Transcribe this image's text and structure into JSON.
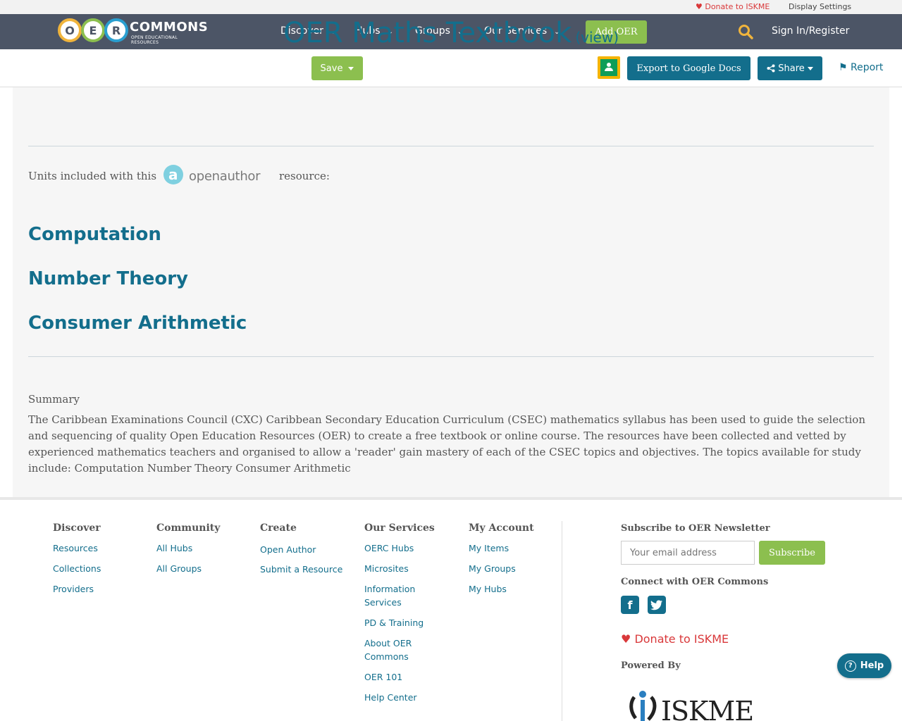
{
  "util_bar": {
    "donate": "Donate to ISKME",
    "display_settings": "Display Settings"
  },
  "logo": {
    "letters": [
      "O",
      "E",
      "R"
    ],
    "name": "COMMONS",
    "tagline": "OPEN EDUCATIONAL RESOURCES"
  },
  "nav": {
    "items": [
      {
        "label": "Discover"
      },
      {
        "label": "Hubs"
      },
      {
        "label": "Groups"
      },
      {
        "label": "Our Services"
      }
    ],
    "add_oer": "Add OER",
    "search_icon": "search-icon",
    "sign_in": "Sign In/Register"
  },
  "toolbar": {
    "save": "Save",
    "classroom_icon": "google-classroom-icon",
    "export": "Export to Google Docs",
    "share": "Share",
    "report": "Report"
  },
  "page": {
    "title": "OER Maths Textbook",
    "view_link": "(view)",
    "units_label": "Units included with this",
    "openauthor_logo": "openauthor",
    "resource_label": "resource:",
    "units": [
      "Computation",
      "Number Theory",
      "Consumer Arithmetic"
    ],
    "summary_heading": "Summary",
    "summary_text": "The Caribbean Examinations Council (CXC) Caribbean Secondary Education Curriculum (CSEC) mathematics syllabus has been used to guide the selection and sequencing of quality Open Education Resources (OER) to create a free textbook or online course. The resources have been collected and vetted by experienced mathematics teachers and organised to allow a 'reader' gain mastery of each of the CSEC topics and objectives. The topics available for study include: Computation Number Theory Consumer Arithmetic"
  },
  "footer": {
    "columns": [
      {
        "heading": "Discover",
        "links": [
          "Resources",
          "Collections",
          "Providers"
        ]
      },
      {
        "heading": "Community",
        "links": [
          "All Hubs",
          "All Groups"
        ]
      },
      {
        "heading": "Create",
        "links": [
          "Open Author",
          "Submit a Resource"
        ]
      },
      {
        "heading": "Our Services",
        "links": [
          "OERC Hubs",
          "Microsites",
          "Information Services",
          "PD & Training",
          "About OER Commons",
          "OER 101",
          "Help Center"
        ]
      },
      {
        "heading": "My Account",
        "links": [
          "My Items",
          "My Groups",
          "My Hubs"
        ]
      }
    ],
    "newsletter_heading": "Subscribe to OER Newsletter",
    "email_placeholder": "Your email address",
    "subscribe": "Subscribe",
    "connect_heading": "Connect with OER Commons",
    "social_icons": [
      "facebook-icon",
      "twitter-icon"
    ],
    "donate": "Donate to ISKME",
    "powered_by": "Powered By",
    "iskme_logo": "ISKME"
  },
  "help_button": "Help",
  "colors": {
    "nav_bg": "#4c5566",
    "accent_green": "#8cbf4f",
    "accent_blue": "#136e8c",
    "donate_red": "#d9383a"
  }
}
